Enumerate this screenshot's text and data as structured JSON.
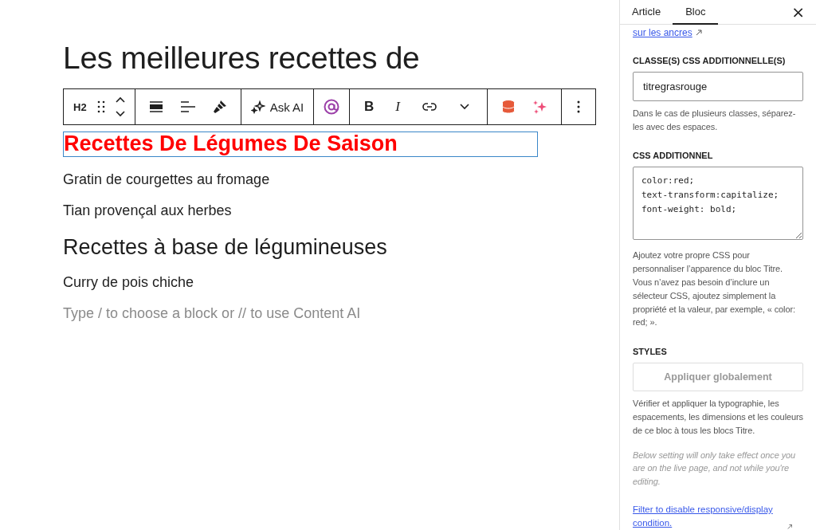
{
  "editor": {
    "title": "Les meilleures recettes de",
    "toolbar": {
      "groups": [
        {
          "items": [
            {
              "kind": "label",
              "text": "H2"
            },
            {
              "kind": "icon"
            },
            {
              "kind": "icon"
            }
          ]
        },
        {
          "items": [
            {
              "kind": "icon"
            },
            {
              "kind": "icon"
            },
            {
              "kind": "icon"
            }
          ]
        },
        {
          "items": [
            {
              "kind": "label",
              "text": "Ask AI"
            }
          ]
        },
        {
          "items": [
            {
              "kind": "icon"
            }
          ]
        },
        {
          "items": [
            {
              "kind": "label",
              "text": "B"
            },
            {
              "kind": "label",
              "text": "I"
            },
            {
              "kind": "icon"
            },
            {
              "kind": "icon"
            }
          ]
        },
        {
          "items": [
            {
              "kind": "icon"
            },
            {
              "kind": "icon"
            }
          ]
        },
        {
          "items": [
            {
              "kind": "icon"
            }
          ]
        }
      ]
    },
    "blocks": [
      {
        "kind": "heading",
        "text": "Recettes De Légumes De Saison",
        "selected": true,
        "color": "#ff0000"
      },
      {
        "kind": "paragraph",
        "text": "Gratin de courgettes au fromage",
        "selected": false
      },
      {
        "kind": "paragraph",
        "text": "Tian provençal aux herbes",
        "selected": false
      },
      {
        "kind": "heading",
        "text": "Recettes à base de légumineuses",
        "selected": false
      },
      {
        "kind": "paragraph",
        "text": "Curry de pois chiche",
        "selected": false
      },
      {
        "kind": "placeholder",
        "text": "Type / to choose a block or // to use Content AI"
      }
    ]
  },
  "sidebar": {
    "tabs": [
      {
        "label": "Article",
        "selected": false
      },
      {
        "label": "Bloc",
        "selected": true
      }
    ],
    "close": "×",
    "sections": [
      {
        "kind": "link",
        "text": "sur les ancres"
      },
      {
        "kind": "heading",
        "text": "CLASSE(S) CSS ADDITIONNELLE(S)"
      },
      {
        "kind": "input",
        "value": "titregrasrouge"
      },
      {
        "kind": "help",
        "text": "Dans le cas de plusieurs classes, séparez-les avec des espaces."
      },
      {
        "kind": "heading",
        "text": "CSS ADDITIONNEL"
      },
      {
        "kind": "textarea",
        "value": "color:red;\ntext-transform:capitalize;\nfont-weight: bold;"
      },
      {
        "kind": "help",
        "text": "Ajoutez votre propre CSS pour personnaliser l’apparence du bloc Titre. Vous n’avez pas besoin d’inclure un sélecteur CSS, ajoutez simplement la propriété et la valeur, par exemple, « color: red; »."
      },
      {
        "kind": "heading",
        "text": "STYLES"
      },
      {
        "kind": "button",
        "text": "Appliquer globalement",
        "disabled": true
      },
      {
        "kind": "help",
        "text": "Vérifier et appliquer la typographie, les espacements, les dimensions et les couleurs de ce bloc à tous les blocs Titre."
      },
      {
        "kind": "note",
        "text": "Below setting will only take effect once you are on the live page, and not while you're editing."
      },
      {
        "kind": "link",
        "text": "Filter to disable responsive/display condition."
      }
    ]
  }
}
